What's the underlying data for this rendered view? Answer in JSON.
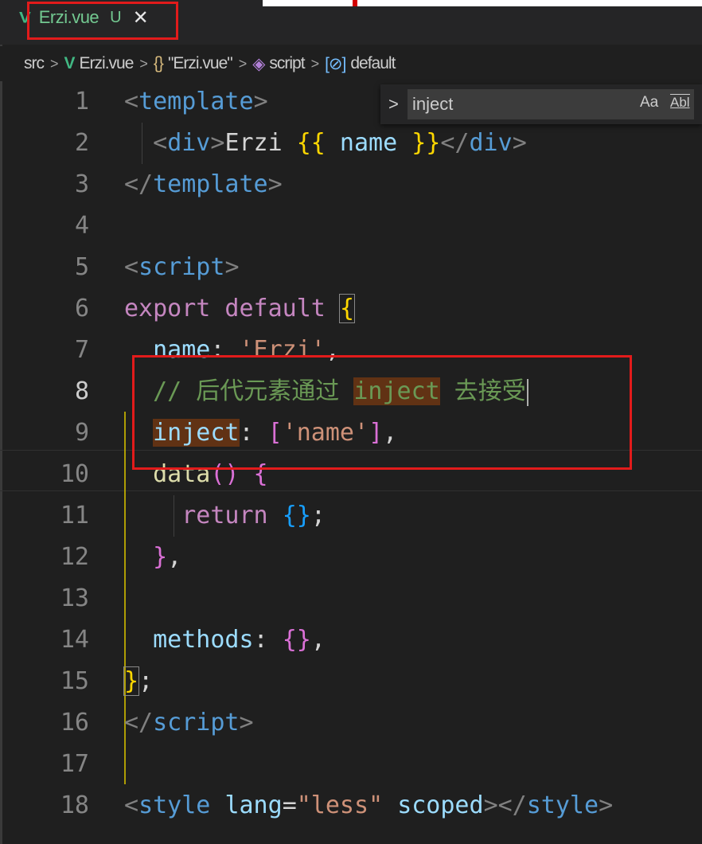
{
  "tab": {
    "filename": "Erzi.vue",
    "status": "U",
    "close": "✕"
  },
  "breadcrumb": {
    "src": "src",
    "file": "Erzi.vue",
    "object": "\"Erzi.vue\"",
    "script": "script",
    "default": "default"
  },
  "find": {
    "value": "inject",
    "match_case_label": "Aa",
    "whole_word_label": "Abl"
  },
  "lines": {
    "n1": "1",
    "n2": "2",
    "n3": "3",
    "n4": "4",
    "n5": "5",
    "n6": "6",
    "n7": "7",
    "n8": "8",
    "n9": "9",
    "n10": "10",
    "n11": "11",
    "n12": "12",
    "n13": "13",
    "n14": "14",
    "n15": "15",
    "n16": "16",
    "n17": "17",
    "n18": "18"
  },
  "code": {
    "l1_open": "<",
    "l1_tag": "template",
    "l1_close": ">",
    "l2_indent": "  ",
    "l2_open": "<",
    "l2_tag": "div",
    "l2_close": ">",
    "l2_text": "Erzi ",
    "l2_mustache_open": "{{",
    "l2_name": " name ",
    "l2_mustache_close": "}}",
    "l2_end_open": "</",
    "l2_end_tag": "div",
    "l2_end_close": ">",
    "l3_open": "</",
    "l3_tag": "template",
    "l3_close": ">",
    "l5_open": "<",
    "l5_tag": "script",
    "l5_close": ">",
    "l6_export": "export",
    "l6_default": " default ",
    "l6_brace": "{",
    "l7_indent": "  ",
    "l7_key": "name",
    "l7_colon": ": ",
    "l7_val": "'Erzi'",
    "l7_comma": ",",
    "l8_indent": "  ",
    "l8_comment_a": "// 后代元素通过 ",
    "l8_match": "inject",
    "l8_comment_b": " 去接受",
    "l9_indent": "  ",
    "l9_key": "inject",
    "l9_colon": ": ",
    "l9_bracket_open": "[",
    "l9_val": "'name'",
    "l9_bracket_close": "]",
    "l9_comma": ",",
    "l10_indent": "  ",
    "l10_fn": "data",
    "l10_parens": "()",
    "l10_brace": " {",
    "l11_indent": "    ",
    "l11_return": "return",
    "l11_space": " ",
    "l11_braces": "{}",
    "l11_semi": ";",
    "l12_indent": "  ",
    "l12_brace": "}",
    "l12_comma": ",",
    "l14_indent": "  ",
    "l14_key": "methods",
    "l14_colon": ": ",
    "l14_braces": "{}",
    "l14_comma": ",",
    "l15_brace": "}",
    "l15_semi": ";",
    "l16_open": "</",
    "l16_tag": "script",
    "l16_close": ">",
    "l18_open": "<",
    "l18_tag": "style",
    "l18_sp1": " ",
    "l18_attr1": "lang",
    "l18_eq": "=",
    "l18_val": "\"less\"",
    "l18_sp2": " ",
    "l18_attr2": "scoped",
    "l18_close1": ">",
    "l18_end_open": "</",
    "l18_end_tag": "style",
    "l18_end_close": ">"
  },
  "colors": {
    "editor_bg": "#1f1f1f",
    "highlight_box": "#e21b1b",
    "vue_green": "#41b883"
  }
}
